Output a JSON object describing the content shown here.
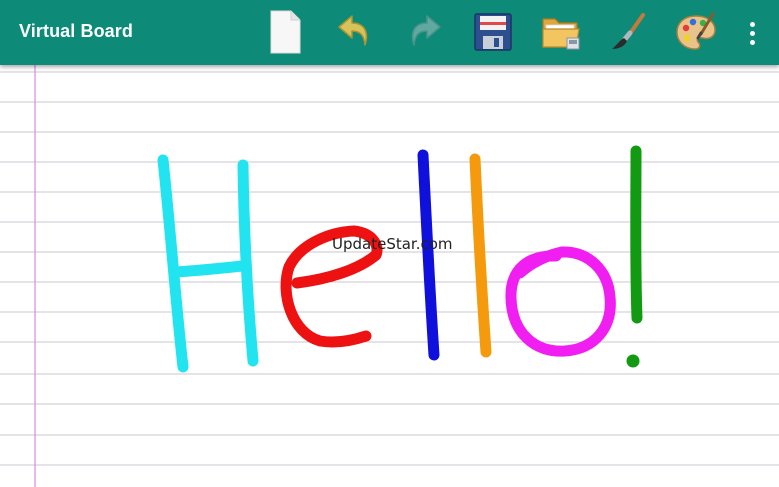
{
  "app": {
    "title": "Virtual Board",
    "accent": "#0e8a78"
  },
  "toolbar": {
    "buttons": [
      {
        "name": "new-page",
        "icon": "new-page-icon"
      },
      {
        "name": "undo",
        "icon": "undo-arrow-icon"
      },
      {
        "name": "redo",
        "icon": "redo-arrow-icon",
        "disabled": true
      },
      {
        "name": "save",
        "icon": "floppy-disk-icon"
      },
      {
        "name": "open",
        "icon": "folder-icon"
      },
      {
        "name": "brush",
        "icon": "paintbrush-icon"
      },
      {
        "name": "palette",
        "icon": "palette-icon"
      },
      {
        "name": "more",
        "icon": "overflow-menu-icon"
      }
    ]
  },
  "board": {
    "paper": "ruled",
    "rule_color": "#c9c9d1",
    "margin_color": "#d98be0",
    "drawing": {
      "text": "Hello!",
      "letters": [
        {
          "char": "H",
          "color": "#22e4f0"
        },
        {
          "char": "e",
          "color": "#ee1111"
        },
        {
          "char": "l",
          "color": "#1010dd"
        },
        {
          "char": "l",
          "color": "#f59a0c"
        },
        {
          "char": "o",
          "color": "#f01ef0"
        },
        {
          "char": "!",
          "color": "#139a13"
        }
      ]
    },
    "watermark": "UpdateStar.com"
  }
}
